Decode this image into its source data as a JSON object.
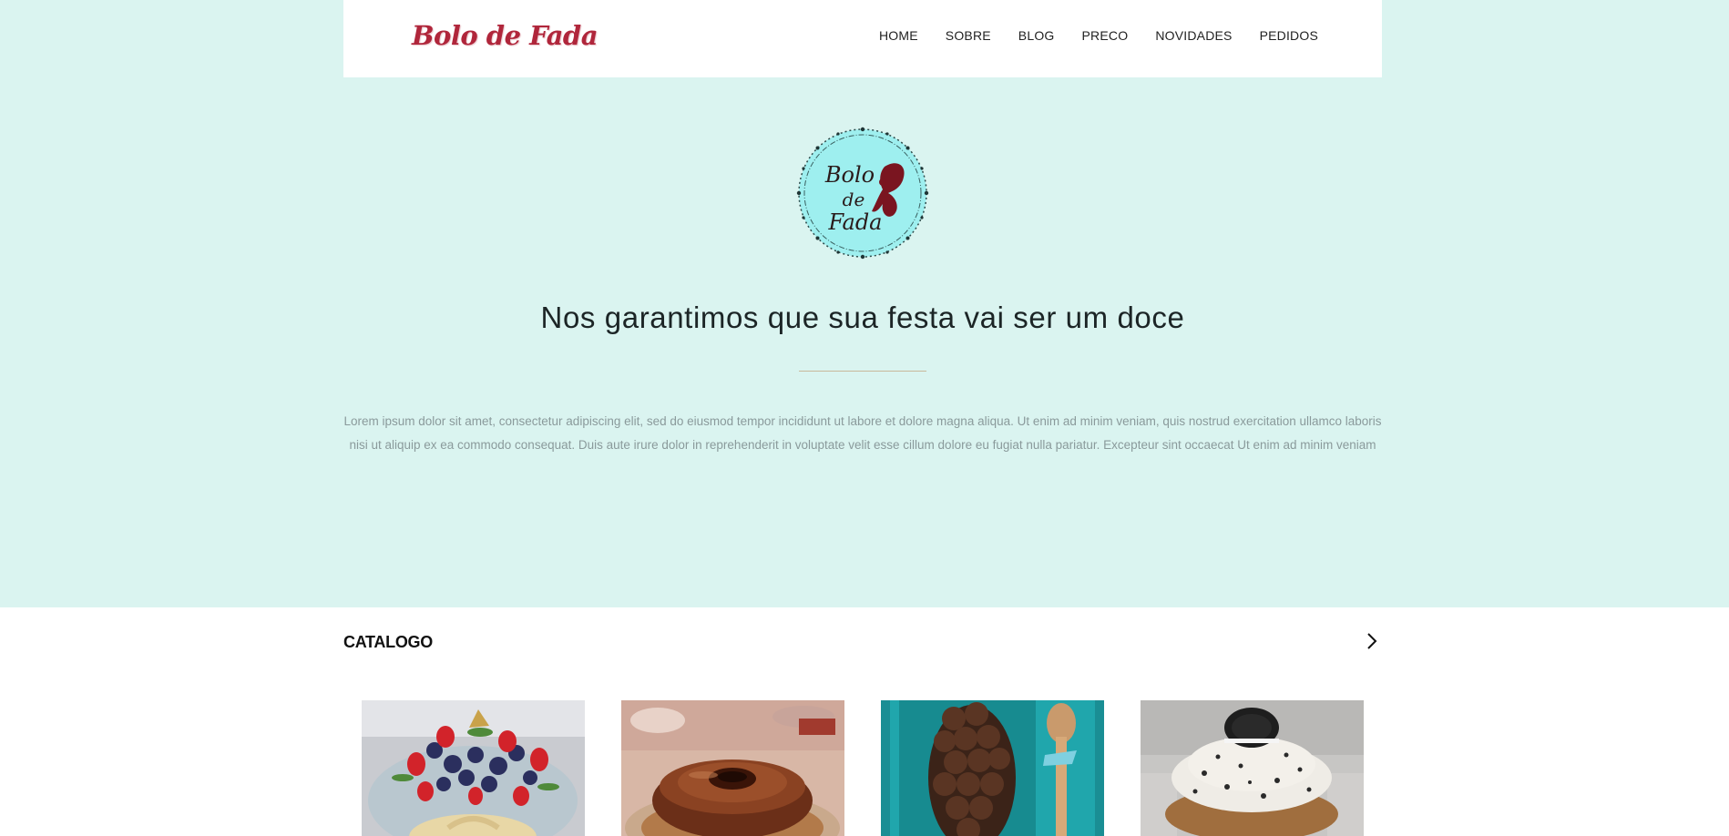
{
  "header": {
    "brand": "Bolo de Fada",
    "nav": [
      "HOME",
      "SOBRE",
      "BLOG",
      "PRECO",
      "NOVIDADES",
      "PEDIDOS"
    ]
  },
  "hero": {
    "emblem_lines": [
      "Bolo",
      "de",
      "Fada"
    ],
    "title": "Nos garantimos que sua festa vai ser um doce",
    "text": "Lorem ipsum dolor sit amet, consectetur adipiscing elit, sed do eiusmod tempor incididunt ut labore et dolore magna aliqua. Ut enim ad minim veniam, quis nostrud exercitation ullamco laboris nisi ut aliquip ex ea commodo consequat. Duis aute irure dolor in reprehenderit in voluptate velit esse cillum dolore eu fugiat nulla pariatur. Excepteur sint occaecat Ut enim ad minim veniam"
  },
  "catalog": {
    "title": "CATALOGO",
    "items": [
      {
        "image": "berry-cake-photo"
      },
      {
        "image": "chocolate-pudding-photo"
      },
      {
        "image": "brigadeiro-box-photo"
      },
      {
        "image": "oreo-dessert-cup-photo"
      }
    ]
  },
  "colors": {
    "background": "#daf4f0",
    "brand": "#b0263b",
    "divider": "#c9b89a"
  }
}
